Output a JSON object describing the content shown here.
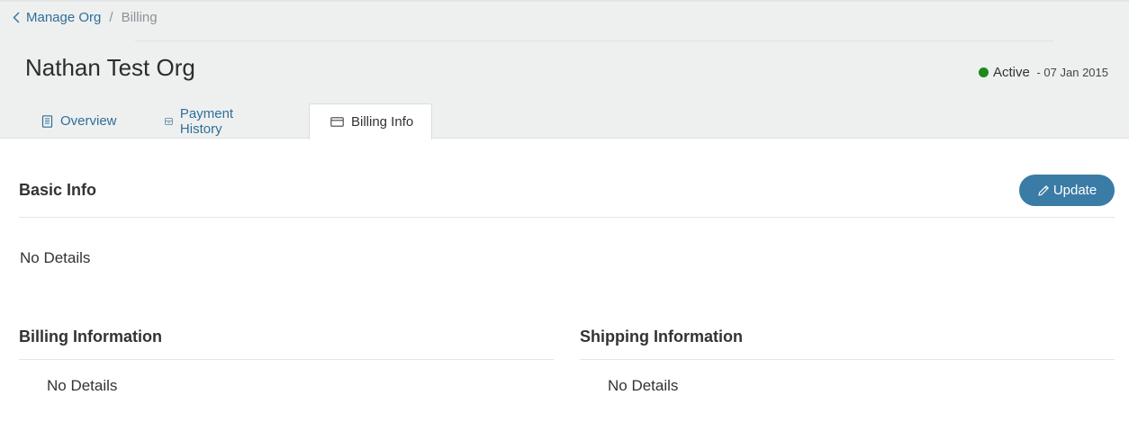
{
  "breadcrumb": {
    "back_label": "Manage Org",
    "separator": "/",
    "current": "Billing"
  },
  "org": {
    "name": "Nathan Test Org",
    "status": "Active",
    "status_separator": "-",
    "status_date": "07 Jan 2015",
    "status_color": "#1a8a1a"
  },
  "tabs": [
    {
      "label": "Overview",
      "icon": "document-icon",
      "active": false
    },
    {
      "label": "Payment History",
      "icon": "inbox-icon",
      "active": false
    },
    {
      "label": "Billing Info",
      "icon": "credit-card-icon",
      "active": true
    }
  ],
  "basic_info": {
    "title": "Basic Info",
    "update_label": "Update",
    "empty_text": "No Details"
  },
  "billing_information": {
    "title": "Billing Information",
    "empty_text": "No Details"
  },
  "shipping_information": {
    "title": "Shipping Information",
    "empty_text": "No Details"
  },
  "colors": {
    "accent": "#3a7ca5",
    "link": "#2f6e98",
    "header_bg": "#eef0f0"
  }
}
